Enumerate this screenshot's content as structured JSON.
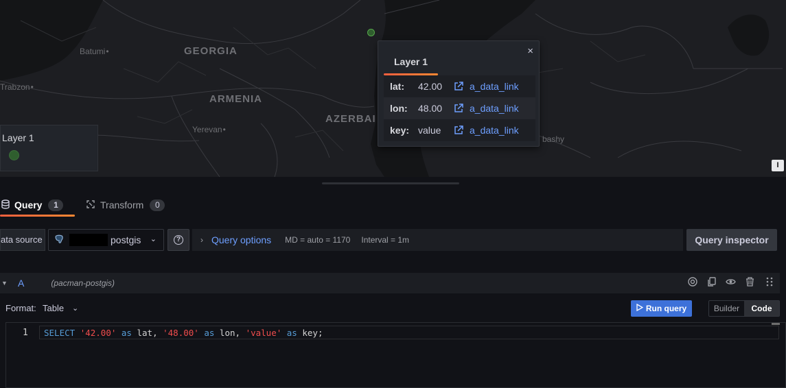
{
  "map": {
    "labels": {
      "batumi": "Batumi",
      "georgia": "GEORGIA",
      "trabzon": "Trabzon",
      "armenia": "ARMENIA",
      "yerevan": "Yerevan",
      "azerbai": "AZERBAI",
      "bashy": "bashy"
    },
    "edge_button": "I",
    "point_color": "#56a64b"
  },
  "legend": {
    "title": "Layer 1"
  },
  "tooltip": {
    "close": "×",
    "tab": "Layer 1",
    "rows": [
      {
        "key": "lat:",
        "value": "42.00",
        "link": "a_data_link"
      },
      {
        "key": "lon:",
        "value": "48.00",
        "link": "a_data_link"
      },
      {
        "key": "key:",
        "value": "value",
        "link": "a_data_link"
      }
    ]
  },
  "tabs": {
    "query": {
      "label": "Query",
      "count": "1"
    },
    "transform": {
      "label": "Transform",
      "count": "0"
    }
  },
  "toolbar": {
    "data_source_label": "ata source",
    "datasource_name": "postgis",
    "help": "?",
    "query_options": "Query options",
    "md": "MD = auto = 1170",
    "interval": "Interval = 1m",
    "query_inspector": "Query inspector"
  },
  "query_row": {
    "ref_id": "A",
    "datasource": "(pacman-postgis)"
  },
  "format": {
    "label": "Format:",
    "value": "Table",
    "run_query": "Run query",
    "builder": "Builder",
    "code": "Code"
  },
  "editor": {
    "line_number": "1",
    "tokens": {
      "select": "SELECT",
      "s1": "'42.00'",
      "as1": "as",
      "lat": " lat, ",
      "s2": "'48.00'",
      "as2": "as",
      "lon": " lon, ",
      "s3": "'value'",
      "as3": "as",
      "key": " key;"
    }
  },
  "colors": {
    "accent_orange": "#f55f3e",
    "link_blue": "#6e9fff",
    "run_button": "#3d71d9"
  }
}
